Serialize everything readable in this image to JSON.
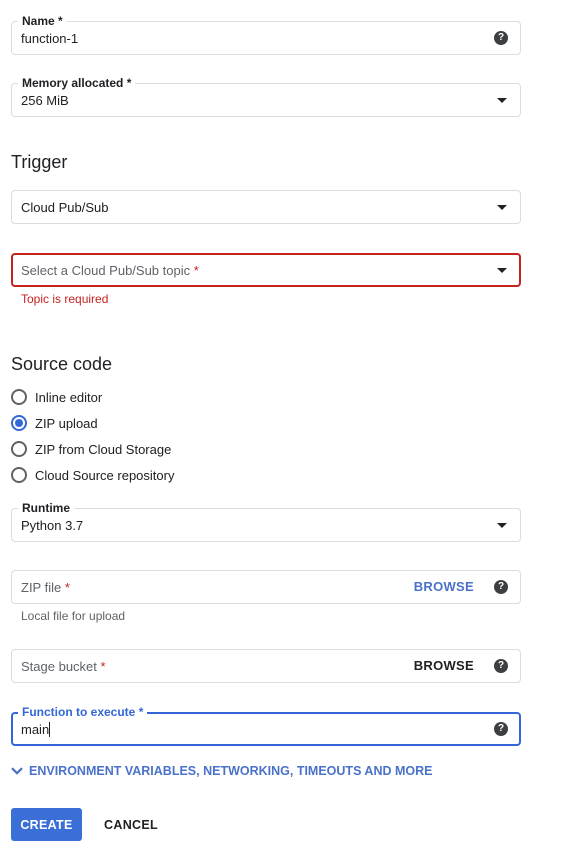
{
  "name_field": {
    "label": "Name",
    "required_mark": "*",
    "value": "function-1",
    "help_icon": "?"
  },
  "memory_field": {
    "label": "Memory allocated",
    "required_mark": "*",
    "value": "256 MiB"
  },
  "trigger": {
    "title": "Trigger",
    "type_value": "Cloud Pub/Sub",
    "topic_placeholder": "Select a Cloud Pub/Sub topic",
    "topic_required_mark": "*",
    "topic_error": "Topic is required"
  },
  "source_code": {
    "title": "Source code",
    "options": [
      {
        "label": "Inline editor",
        "checked": false
      },
      {
        "label": "ZIP upload",
        "checked": true
      },
      {
        "label": "ZIP from Cloud Storage",
        "checked": false
      },
      {
        "label": "Cloud Source repository",
        "checked": false
      }
    ]
  },
  "runtime_field": {
    "label": "Runtime",
    "value": "Python 3.7"
  },
  "zip_file_field": {
    "placeholder": "ZIP file",
    "required_mark": "*",
    "browse_label": "BROWSE",
    "hint": "Local file for upload",
    "help_icon": "?"
  },
  "stage_bucket_field": {
    "placeholder": "Stage bucket",
    "required_mark": "*",
    "browse_label": "BROWSE",
    "help_icon": "?"
  },
  "function_field": {
    "label": "Function to execute",
    "required_mark": "*",
    "value": "main",
    "help_icon": "?"
  },
  "advanced_expander": {
    "label": "ENVIRONMENT VARIABLES, NETWORKING, TIMEOUTS AND MORE",
    "icon": "chevron-down-icon"
  },
  "actions": {
    "create_label": "CREATE",
    "cancel_label": "CANCEL"
  },
  "colors": {
    "accent": "#3367d6",
    "error": "#c5221f",
    "create_button": "#3b6fd8"
  }
}
